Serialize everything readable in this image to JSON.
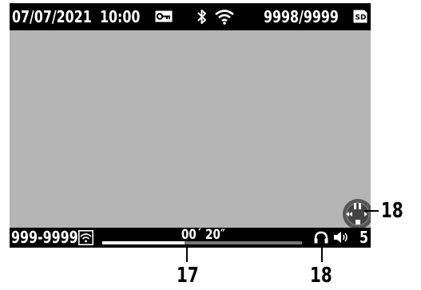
{
  "status_bar": {
    "date": "07/07/2021",
    "time": "10:00",
    "protect_icon": "key-icon",
    "bluetooth_icon": "bluetooth-icon",
    "wifi_icon": "wifi-icon",
    "file_counter": "9998/9999",
    "card_icon": "sd-card-icon",
    "card_label": "SD"
  },
  "playback_bar": {
    "folder_file": "999-9999",
    "wifi_status_icon": "wifi-box-icon",
    "elapsed_time": "00´ 20″",
    "progress": 0.41,
    "headphone_icon": "headphone-icon",
    "speaker_icon": "speaker-icon",
    "volume_level": "5"
  },
  "controls": {
    "four_way_icon": "four-way-controller-icon"
  },
  "callouts": {
    "progress_number": "17",
    "headphone_number": "18",
    "controller_number": "18"
  }
}
